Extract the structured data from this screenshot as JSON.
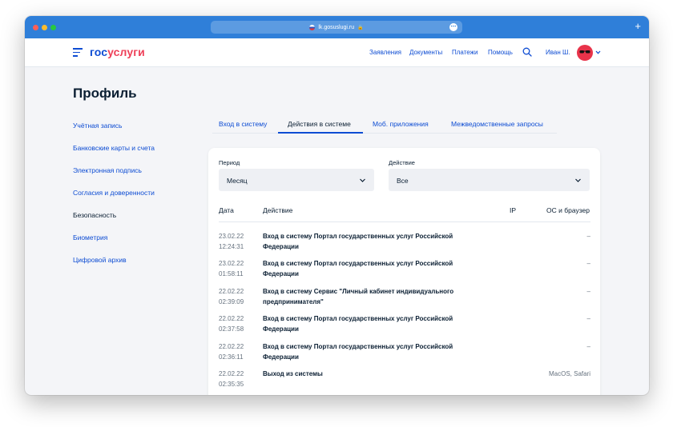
{
  "browser": {
    "url": "lk.gosuslugi.ru",
    "new_tab": "+"
  },
  "header": {
    "logo_part1": "гос",
    "logo_part2": "услуги",
    "nav": [
      "Заявления",
      "Документы",
      "Платежи",
      "Помощь"
    ],
    "user_name": "Иван Ш.",
    "icons": {
      "menu": "burger-menu-icon",
      "search": "search-icon",
      "avatar": "avatar-sunglasses-icon",
      "dropdown": "chevron-down-icon"
    }
  },
  "page": {
    "title": "Профиль"
  },
  "sidebar": {
    "items": [
      {
        "label": "Учётная запись",
        "active": false
      },
      {
        "label": "Банковские карты и счета",
        "active": false
      },
      {
        "label": "Электронная подпись",
        "active": false
      },
      {
        "label": "Согласия и доверенности",
        "active": false
      },
      {
        "label": "Безопасность",
        "active": true
      },
      {
        "label": "Биометрия",
        "active": false
      },
      {
        "label": "Цифровой архив",
        "active": false
      }
    ]
  },
  "tabs": [
    {
      "label": "Вход в систему",
      "active": false
    },
    {
      "label": "Действия в системе",
      "active": true
    },
    {
      "label": "Моб. приложения",
      "active": false
    },
    {
      "label": "Межведомственные запросы",
      "active": false
    }
  ],
  "filters": {
    "period": {
      "label": "Период",
      "value": "Месяц"
    },
    "action": {
      "label": "Действие",
      "value": "Все"
    }
  },
  "table": {
    "columns": [
      "Дата",
      "Действие",
      "IP",
      "ОС и браузер"
    ],
    "rows": [
      {
        "date": "23.02.22",
        "time": "12:24:31",
        "action": "Вход в систему Портал государственных услуг Российской Федерации",
        "ip": "",
        "os": "–"
      },
      {
        "date": "23.02.22",
        "time": "01:58:11",
        "action": "Вход в систему Портал государственных услуг Российской Федерации",
        "ip": "",
        "os": "–"
      },
      {
        "date": "22.02.22",
        "time": "02:39:09",
        "action": "Вход в систему Сервис \"Личный кабинет индивидуального предпринимателя\"",
        "ip": "",
        "os": "–"
      },
      {
        "date": "22.02.22",
        "time": "02:37:58",
        "action": "Вход в систему Портал государственных услуг Российской Федерации",
        "ip": "",
        "os": "–"
      },
      {
        "date": "22.02.22",
        "time": "02:36:11",
        "action": "Вход в систему Портал государственных услуг Российской Федерации",
        "ip": "",
        "os": "–"
      },
      {
        "date": "22.02.22",
        "time": "02:35:35",
        "action": "Выход из системы",
        "ip": "",
        "os": "MacOS, Safari"
      }
    ]
  },
  "colors": {
    "brand_blue": "#0d4cd3",
    "brand_red": "#ee3f58",
    "titlebar": "#2f7fd9",
    "page_bg": "#f4f5f8"
  }
}
